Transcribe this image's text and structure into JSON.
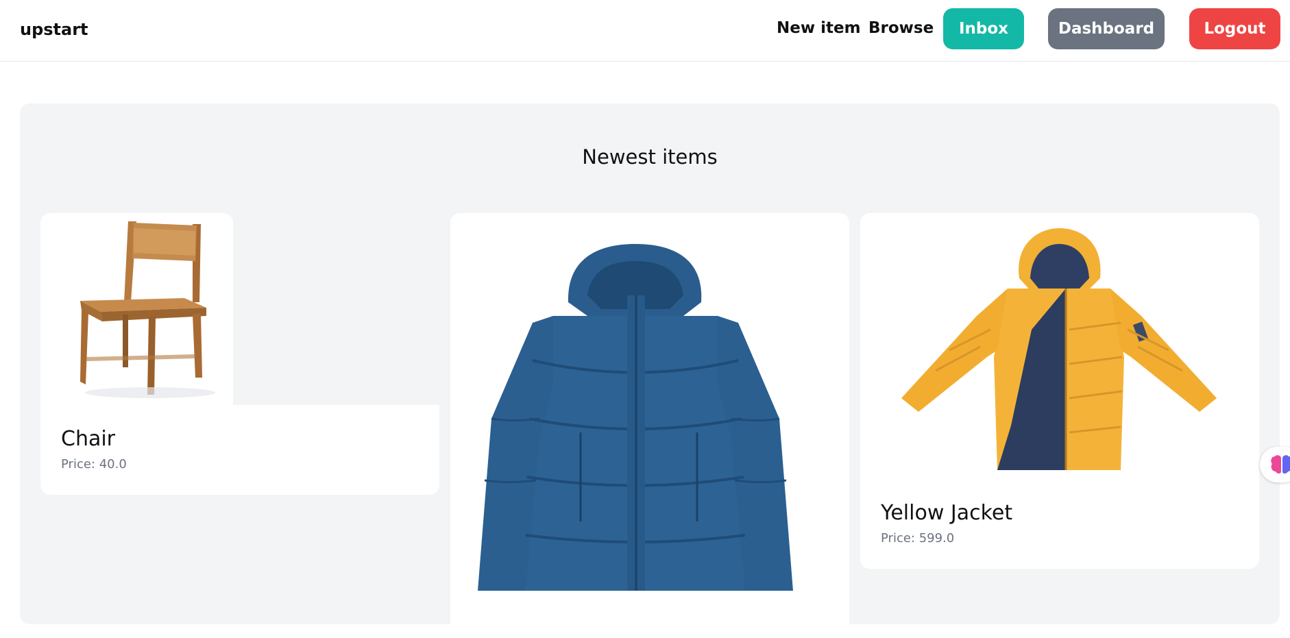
{
  "brand": "upstart",
  "nav": {
    "new_item": "New item",
    "browse": "Browse",
    "inbox": "Inbox",
    "dashboard": "Dashboard",
    "logout": "Logout"
  },
  "colors": {
    "inbox": "#14b8a6",
    "dashboard": "#6b7280",
    "logout": "#ef4444",
    "section_bg": "#f3f4f6"
  },
  "section": {
    "title": "Newest items"
  },
  "items": [
    {
      "name": "Chair",
      "price": "Price: 40.0",
      "image_icon": "chair-image"
    },
    {
      "name": "",
      "price": "",
      "image_icon": "blue-jacket-image"
    },
    {
      "name": "Yellow Jacket",
      "price": "Price: 599.0",
      "image_icon": "yellow-jacket-image"
    }
  ],
  "side_widget": {
    "icon": "brain-icon"
  }
}
